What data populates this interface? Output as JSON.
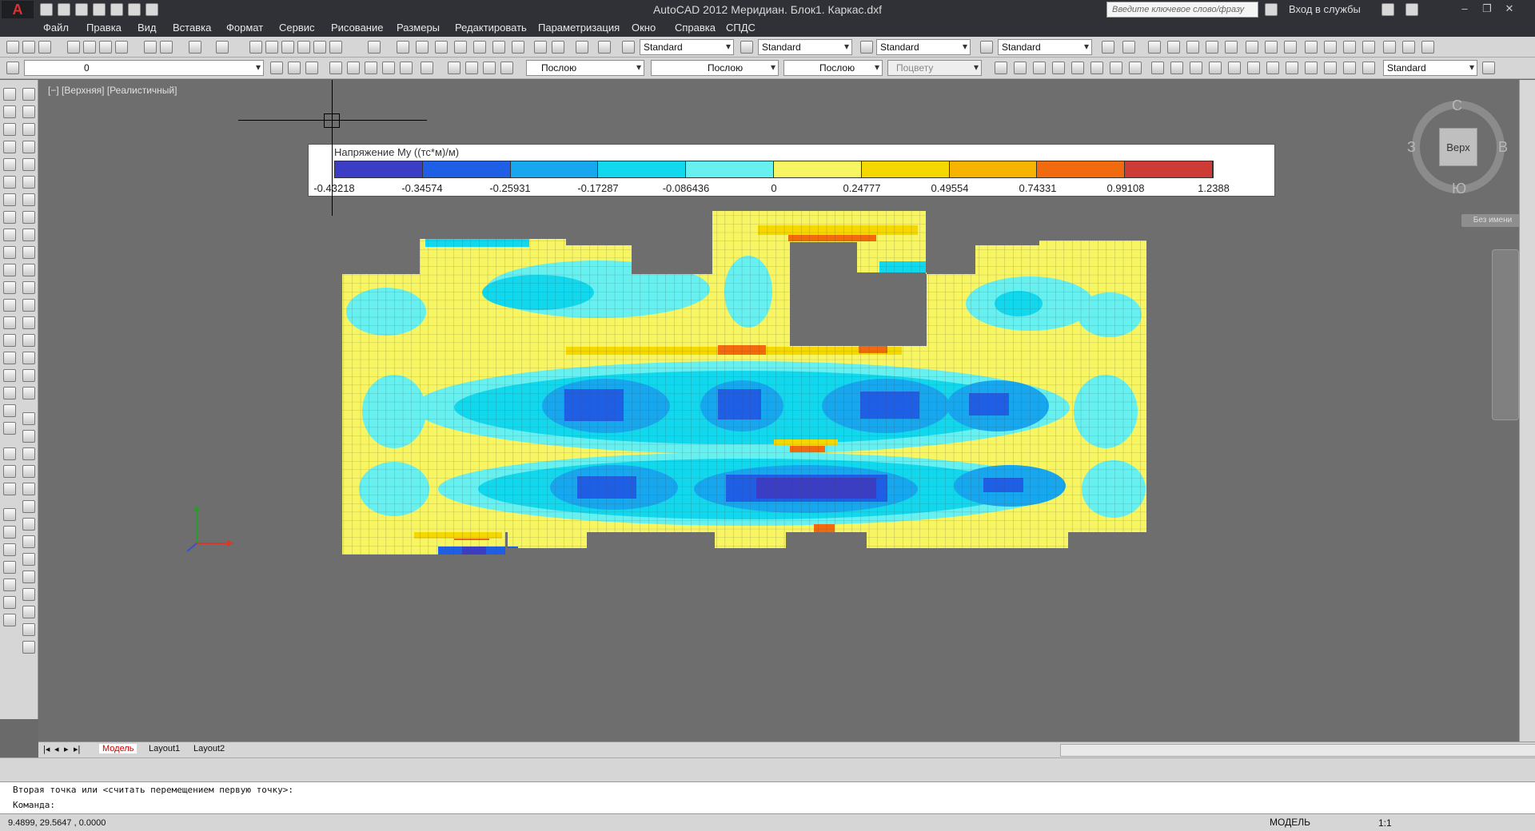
{
  "app": {
    "title": "AutoCAD 2012    Меридиан. Блок1. Каркас.dxf",
    "search_placeholder": "Введите ключевое слово/фразу",
    "login_label": "Вход в службы"
  },
  "menu": [
    "Файл",
    "Правка",
    "Вид",
    "Вставка",
    "Формат",
    "Сервис",
    "Рисование",
    "Размеры",
    "Редактировать",
    "Параметризация",
    "Окно",
    "Справка",
    "СПДС"
  ],
  "toolbar1": {
    "text_style": "Standard",
    "dim_style": "Standard",
    "table_style": "Standard",
    "mleader_style": "Standard"
  },
  "toolbar2": {
    "layer": "0",
    "color": "Послою",
    "linetype": "Послою",
    "lineweight": "Послою",
    "plotstyle": "Поцвету",
    "dim_style": "Standard"
  },
  "viewport": {
    "label": "[−] [Верхняя] [Реалистичный]"
  },
  "legend": {
    "title": "Напряжение My ((тс*м)/м)",
    "colors": [
      "#3b3ec4",
      "#1f5fe6",
      "#17a7ef",
      "#12d8ee",
      "#66f0f0",
      "#f7f562",
      "#f5d800",
      "#f6b400",
      "#f26a0e",
      "#cc3b36"
    ],
    "labels": [
      "-0.43218",
      "-0.34574",
      "-0.25931",
      "-0.17287",
      "-0.086436",
      "0",
      "0.24777",
      "0.49554",
      "0.74331",
      "0.99108",
      "1.2388"
    ]
  },
  "viewcube": {
    "north": "С",
    "south": "Ю",
    "west": "З",
    "east": "В",
    "face": "Верх",
    "wcs_name": "Без имени"
  },
  "tabs": {
    "model": "Модель",
    "layout1": "Layout1",
    "layout2": "Layout2"
  },
  "command": {
    "history": "Вторая точка или <считать перемещением первую точку>:",
    "prompt": "Команда:"
  },
  "status": {
    "coords": "9.4899,  29.5647 , 0.0000",
    "model": "МОДЕЛЬ",
    "scale": "1:1"
  }
}
